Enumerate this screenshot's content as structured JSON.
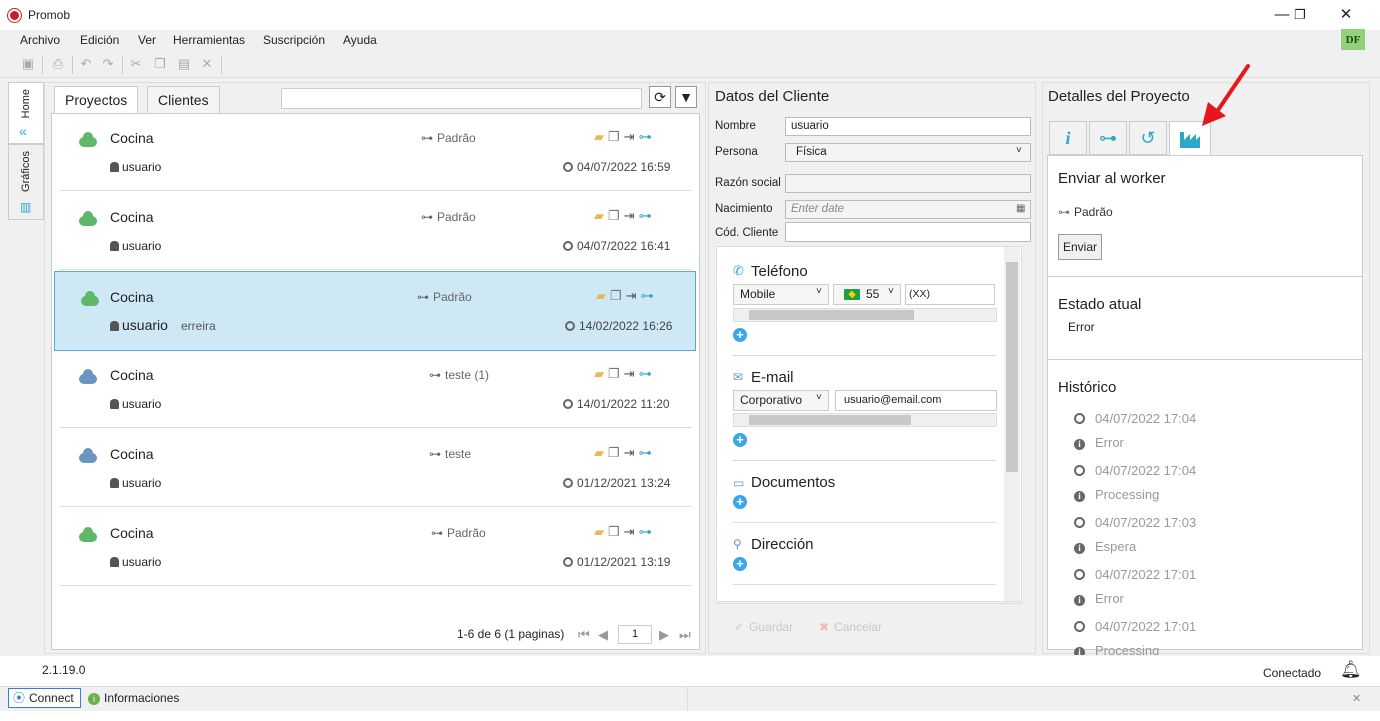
{
  "window": {
    "title": "Promob",
    "minimize": "—",
    "maximize": "❐",
    "close": "✕"
  },
  "menu": [
    "Archivo",
    "Edición",
    "Ver",
    "Herramientas",
    "Suscripción",
    "Ayuda"
  ],
  "user_initials": "DF",
  "side_tabs": {
    "home": "Home",
    "graphics": "Gráficos"
  },
  "projects": {
    "tabs": [
      "Proyectos",
      "Clientes"
    ],
    "search_placeholder": "",
    "rows": [
      {
        "title": "Cocina",
        "branch": "Padrão",
        "user": "usuario",
        "extra": "",
        "date": "04/07/2022 16:59",
        "cloud": "#5fb86a"
      },
      {
        "title": "Cocina",
        "branch": "Padrão",
        "user": "usuario",
        "extra": "",
        "date": "04/07/2022 16:41",
        "cloud": "#5fb86a"
      },
      {
        "title": "Cocina",
        "branch": "Padrão",
        "user": "usuario",
        "extra": "erreira",
        "date": "14/02/2022 16:26",
        "cloud": "#5fb86a"
      },
      {
        "title": "Cocina",
        "branch": "teste (1)",
        "user": "usuario",
        "extra": "",
        "date": "14/01/2022 11:20",
        "cloud": "#6a95c0"
      },
      {
        "title": "Cocina",
        "branch": "teste",
        "user": "usuario",
        "extra": "",
        "date": "01/12/2021 13:24",
        "cloud": "#6a95c0"
      },
      {
        "title": "Cocina",
        "branch": "Padrão",
        "user": "usuario",
        "extra": "",
        "date": "01/12/2021 13:19",
        "cloud": "#5fb86a"
      }
    ],
    "selected_index": 2,
    "pager_text": "1-6 de 6 (1 paginas)",
    "page": "1"
  },
  "client": {
    "title": "Datos del Cliente",
    "fields": [
      {
        "label": "Nombre",
        "value": "usuario",
        "placeholder": ""
      },
      {
        "label": "Persona",
        "value": "Física",
        "placeholder": ""
      },
      {
        "label": "Razón social",
        "value": "",
        "placeholder": ""
      },
      {
        "label": "Nacimiento",
        "value": "",
        "placeholder": "Enter date"
      },
      {
        "label": "Cód. Cliente",
        "value": "",
        "placeholder": ""
      }
    ],
    "phone": {
      "title": "Teléfono",
      "type": "Mobile",
      "country_code": "55",
      "number": "(XX)  XXXXXXXXX"
    },
    "email": {
      "title": "E-mail",
      "type": "Corporativo",
      "value": "usuario@email.com"
    },
    "documents_title": "Documentos",
    "address_title": "Dirección",
    "save_label": "Guardar",
    "cancel_label": "Cancelar"
  },
  "details": {
    "title": "Detalles del Proyecto",
    "send_section": "Enviar al worker",
    "branch": "Padrão",
    "send_button": "Enviar",
    "state_section": "Estado atual",
    "state_value": "Error",
    "history_section": "Histórico",
    "history": [
      {
        "date": "04/07/2022 17:04",
        "status": "Error"
      },
      {
        "date": "04/07/2022 17:04",
        "status": "Processing"
      },
      {
        "date": "04/07/2022 17:03",
        "status": "Espera"
      },
      {
        "date": "04/07/2022 17:01",
        "status": "Error"
      },
      {
        "date": "04/07/2022 17:01",
        "status": "Processing"
      }
    ]
  },
  "status": {
    "version": "2.1.19.0",
    "connection": "Conectado",
    "connect_button": "Connect",
    "info_button": "Informaciones"
  },
  "colors": {
    "accent": "#3aa8e8",
    "selected_row": "#cfe8f6",
    "annotation_arrow": "#e8161b"
  }
}
